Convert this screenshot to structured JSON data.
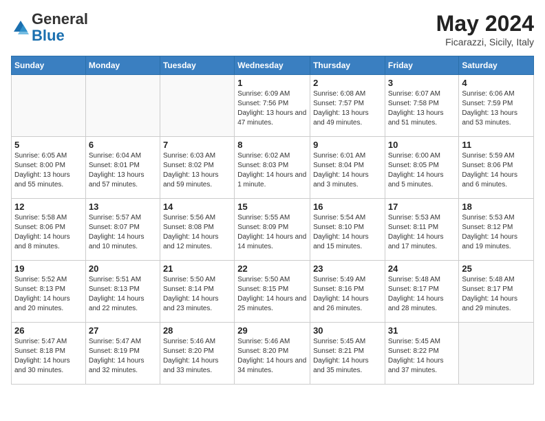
{
  "header": {
    "logo_line1": "General",
    "logo_line2": "Blue",
    "title": "May 2024",
    "subtitle": "Ficarazzi, Sicily, Italy"
  },
  "days_of_week": [
    "Sunday",
    "Monday",
    "Tuesday",
    "Wednesday",
    "Thursday",
    "Friday",
    "Saturday"
  ],
  "weeks": [
    [
      {
        "num": "",
        "info": ""
      },
      {
        "num": "",
        "info": ""
      },
      {
        "num": "",
        "info": ""
      },
      {
        "num": "1",
        "info": "Sunrise: 6:09 AM\nSunset: 7:56 PM\nDaylight: 13 hours and 47 minutes."
      },
      {
        "num": "2",
        "info": "Sunrise: 6:08 AM\nSunset: 7:57 PM\nDaylight: 13 hours and 49 minutes."
      },
      {
        "num": "3",
        "info": "Sunrise: 6:07 AM\nSunset: 7:58 PM\nDaylight: 13 hours and 51 minutes."
      },
      {
        "num": "4",
        "info": "Sunrise: 6:06 AM\nSunset: 7:59 PM\nDaylight: 13 hours and 53 minutes."
      }
    ],
    [
      {
        "num": "5",
        "info": "Sunrise: 6:05 AM\nSunset: 8:00 PM\nDaylight: 13 hours and 55 minutes."
      },
      {
        "num": "6",
        "info": "Sunrise: 6:04 AM\nSunset: 8:01 PM\nDaylight: 13 hours and 57 minutes."
      },
      {
        "num": "7",
        "info": "Sunrise: 6:03 AM\nSunset: 8:02 PM\nDaylight: 13 hours and 59 minutes."
      },
      {
        "num": "8",
        "info": "Sunrise: 6:02 AM\nSunset: 8:03 PM\nDaylight: 14 hours and 1 minute."
      },
      {
        "num": "9",
        "info": "Sunrise: 6:01 AM\nSunset: 8:04 PM\nDaylight: 14 hours and 3 minutes."
      },
      {
        "num": "10",
        "info": "Sunrise: 6:00 AM\nSunset: 8:05 PM\nDaylight: 14 hours and 5 minutes."
      },
      {
        "num": "11",
        "info": "Sunrise: 5:59 AM\nSunset: 8:06 PM\nDaylight: 14 hours and 6 minutes."
      }
    ],
    [
      {
        "num": "12",
        "info": "Sunrise: 5:58 AM\nSunset: 8:06 PM\nDaylight: 14 hours and 8 minutes."
      },
      {
        "num": "13",
        "info": "Sunrise: 5:57 AM\nSunset: 8:07 PM\nDaylight: 14 hours and 10 minutes."
      },
      {
        "num": "14",
        "info": "Sunrise: 5:56 AM\nSunset: 8:08 PM\nDaylight: 14 hours and 12 minutes."
      },
      {
        "num": "15",
        "info": "Sunrise: 5:55 AM\nSunset: 8:09 PM\nDaylight: 14 hours and 14 minutes."
      },
      {
        "num": "16",
        "info": "Sunrise: 5:54 AM\nSunset: 8:10 PM\nDaylight: 14 hours and 15 minutes."
      },
      {
        "num": "17",
        "info": "Sunrise: 5:53 AM\nSunset: 8:11 PM\nDaylight: 14 hours and 17 minutes."
      },
      {
        "num": "18",
        "info": "Sunrise: 5:53 AM\nSunset: 8:12 PM\nDaylight: 14 hours and 19 minutes."
      }
    ],
    [
      {
        "num": "19",
        "info": "Sunrise: 5:52 AM\nSunset: 8:13 PM\nDaylight: 14 hours and 20 minutes."
      },
      {
        "num": "20",
        "info": "Sunrise: 5:51 AM\nSunset: 8:13 PM\nDaylight: 14 hours and 22 minutes."
      },
      {
        "num": "21",
        "info": "Sunrise: 5:50 AM\nSunset: 8:14 PM\nDaylight: 14 hours and 23 minutes."
      },
      {
        "num": "22",
        "info": "Sunrise: 5:50 AM\nSunset: 8:15 PM\nDaylight: 14 hours and 25 minutes."
      },
      {
        "num": "23",
        "info": "Sunrise: 5:49 AM\nSunset: 8:16 PM\nDaylight: 14 hours and 26 minutes."
      },
      {
        "num": "24",
        "info": "Sunrise: 5:48 AM\nSunset: 8:17 PM\nDaylight: 14 hours and 28 minutes."
      },
      {
        "num": "25",
        "info": "Sunrise: 5:48 AM\nSunset: 8:17 PM\nDaylight: 14 hours and 29 minutes."
      }
    ],
    [
      {
        "num": "26",
        "info": "Sunrise: 5:47 AM\nSunset: 8:18 PM\nDaylight: 14 hours and 30 minutes."
      },
      {
        "num": "27",
        "info": "Sunrise: 5:47 AM\nSunset: 8:19 PM\nDaylight: 14 hours and 32 minutes."
      },
      {
        "num": "28",
        "info": "Sunrise: 5:46 AM\nSunset: 8:20 PM\nDaylight: 14 hours and 33 minutes."
      },
      {
        "num": "29",
        "info": "Sunrise: 5:46 AM\nSunset: 8:20 PM\nDaylight: 14 hours and 34 minutes."
      },
      {
        "num": "30",
        "info": "Sunrise: 5:45 AM\nSunset: 8:21 PM\nDaylight: 14 hours and 35 minutes."
      },
      {
        "num": "31",
        "info": "Sunrise: 5:45 AM\nSunset: 8:22 PM\nDaylight: 14 hours and 37 minutes."
      },
      {
        "num": "",
        "info": ""
      }
    ]
  ]
}
